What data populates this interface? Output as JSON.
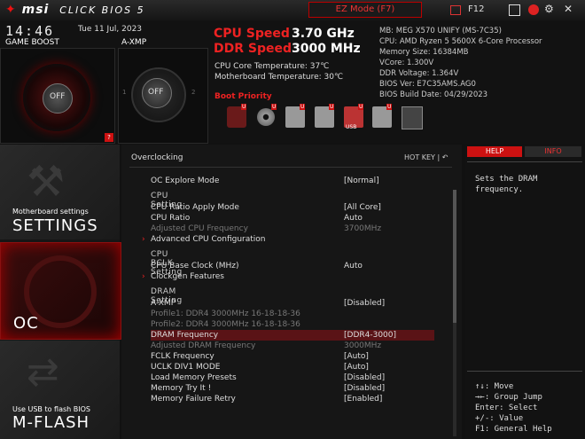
{
  "topbar": {
    "brand": "msi",
    "bios_name": "CLICK BIOS 5",
    "ez_mode": "EZ Mode (F7)",
    "f12": "F12",
    "icons": [
      "screenshot-icon",
      "search-icon",
      "language-icon",
      "settings-icon",
      "close-icon"
    ]
  },
  "clock": {
    "time": "14:46",
    "date": "Tue  11 Jul, 2023"
  },
  "game_boost": {
    "label": "GAME BOOST",
    "state": "OFF"
  },
  "axmp": {
    "label": "A-XMP",
    "state": "OFF",
    "left_num": "1",
    "right_num": "2"
  },
  "badge": "?",
  "speeds": {
    "cpu_label": "CPU Speed",
    "cpu_val": "3.70 GHz",
    "ddr_label": "DDR Speed",
    "ddr_val": "3000 MHz",
    "cpu_temp": "CPU Core Temperature: 37℃",
    "mb_temp": "Motherboard Temperature: 30℃"
  },
  "sysinfo": [
    "MB: MEG X570 UNIFY (MS-7C35)",
    "CPU: AMD Ryzen 5 5600X 6-Core Processor",
    "Memory Size: 16384MB",
    "VCore: 1.300V",
    "DDR Voltage: 1.364V",
    "BIOS Ver: E7C35AMS.AG0",
    "BIOS Build Date: 04/29/2023"
  ],
  "boot": {
    "label": "Boot Priority",
    "badges": [
      "U",
      "U",
      "U",
      "U",
      "U",
      "U"
    ],
    "usb_label": "USB"
  },
  "nav": {
    "settings_sub": "Motherboard settings",
    "settings_title": "SETTINGS",
    "oc_title": "OC",
    "mflash_sub": "Use USB to flash BIOS",
    "mflash_title": "M-FLASH"
  },
  "main": {
    "crumb": "Overclocking",
    "hotkey": "HOT KEY  |  ↶",
    "items": [
      {
        "k": "OC Explore Mode",
        "v": "[Normal]"
      },
      {
        "section": "CPU  Setting"
      },
      {
        "k": "CPU Ratio Apply Mode",
        "v": "[All Core]"
      },
      {
        "k": "CPU Ratio",
        "v": "Auto"
      },
      {
        "k": "Adjusted CPU Frequency",
        "v": "3700MHz",
        "dim": true
      },
      {
        "k": "Advanced CPU Configuration",
        "v": "",
        "arrow": true
      },
      {
        "section": "CPU  BCLK  Setting"
      },
      {
        "k": "CPU Base Clock (MHz)",
        "v": "Auto"
      },
      {
        "k": "Clockgen Features",
        "v": "",
        "arrow": true
      },
      {
        "section": "DRAM  Setting"
      },
      {
        "k": "A-XMP",
        "v": "[Disabled]"
      },
      {
        "k": "Profile1: DDR4 3000MHz 16-18-18-36",
        "v": "",
        "dim": true
      },
      {
        "k": "Profile2: DDR4 3000MHz 16-18-18-36",
        "v": "",
        "dim": true
      },
      {
        "k": "DRAM Frequency",
        "v": "[DDR4-3000]",
        "hi": true
      },
      {
        "k": "Adjusted DRAM Frequency",
        "v": "3000MHz",
        "dim": true
      },
      {
        "k": "FCLK Frequency",
        "v": "[Auto]"
      },
      {
        "k": "UCLK DIV1 MODE",
        "v": "[Auto]"
      },
      {
        "k": "Load Memory Presets",
        "v": "[Disabled]"
      },
      {
        "k": "Memory Try It !",
        "v": "[Disabled]"
      },
      {
        "k": "Memory Failure Retry",
        "v": "[Enabled]"
      }
    ]
  },
  "help": {
    "tab_help": "HELP",
    "tab_info": "INFO",
    "text": "Sets the DRAM frequency.",
    "keys": [
      "↑↓: Move",
      "→←: Group Jump",
      "Enter: Select",
      "+/-: Value",
      "F1: General Help"
    ]
  },
  "colors": {
    "accent": "#e01b24",
    "highlight_row": "#5a1316"
  }
}
